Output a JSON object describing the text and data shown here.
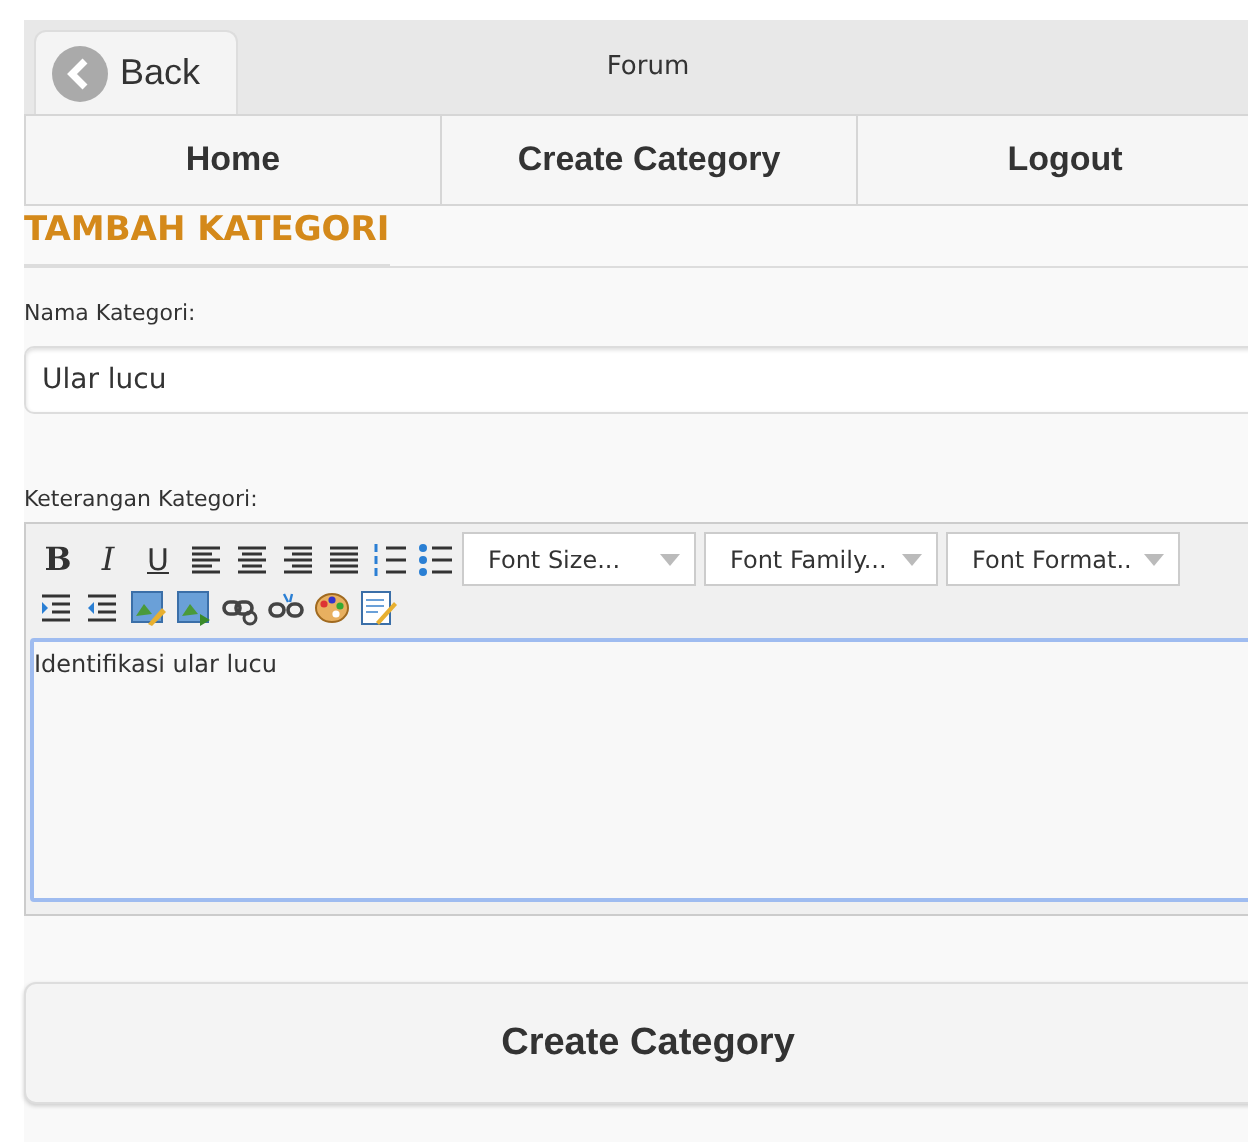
{
  "header": {
    "back_label": "Back",
    "title": "Forum"
  },
  "nav": [
    {
      "label": "Home",
      "selected": false
    },
    {
      "label": "Create Category",
      "selected": false
    },
    {
      "label": "Logout",
      "selected": false
    }
  ],
  "heading": "TAMBAH KATEGORI",
  "name_field": {
    "label": "Nama Kategori:",
    "value": "Ular lucu"
  },
  "description_editor": {
    "label": "Keterangan Kategori:",
    "format_buttons": [
      "B",
      "I",
      "U"
    ],
    "dropdowns": [
      "Font Size...",
      "Font Family...",
      "Font Format.."
    ],
    "value": "Identifikasi ular lucu"
  },
  "submit_label": "Create Category"
}
